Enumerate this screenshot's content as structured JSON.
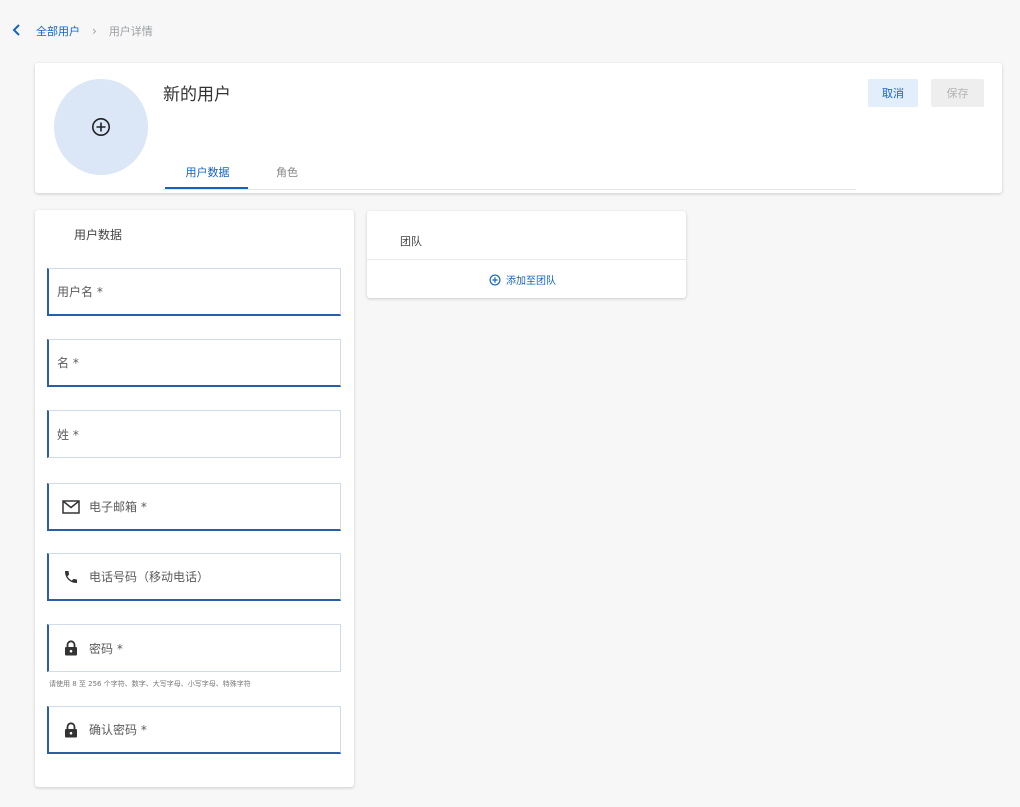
{
  "breadcrumb": {
    "parent": "全部用户",
    "separator": "›",
    "current": "用户详情"
  },
  "header": {
    "user_title": "新的用户",
    "tabs": [
      {
        "label": "用户数据",
        "active": true
      },
      {
        "label": "角色",
        "active": false
      }
    ],
    "cancel_label": "取消",
    "save_label": "保存"
  },
  "user_data": {
    "heading": "用户数据",
    "fields": {
      "username": "用户名 *",
      "first_name": "名 *",
      "last_name": "姓 *",
      "email": "电子邮箱 *",
      "phone": "电话号码（移动电话）",
      "password": "密码 *",
      "confirm_password": "确认密码 *"
    },
    "password_hint": "请使用 8 至 256 个字符、数字、大写字母、小写字母、特殊字符"
  },
  "team": {
    "heading": "团队",
    "add_label": "添加至团队"
  },
  "colors": {
    "accent": "#1565c0",
    "avatar_bg": "#dbe7f6",
    "cancel_bg": "#e3eefb",
    "save_disabled_bg": "#eeeeee",
    "page_bg": "#f7f7f7"
  },
  "icons": [
    "chevron-left-icon",
    "add-circle-icon",
    "mail-icon",
    "phone-icon",
    "lock-icon"
  ]
}
